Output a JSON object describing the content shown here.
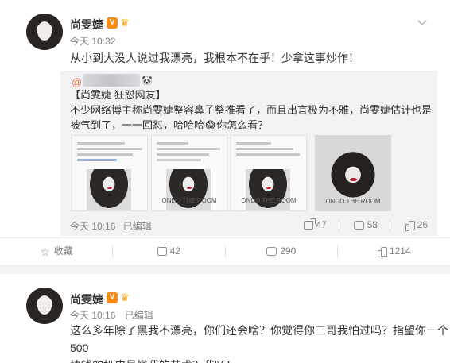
{
  "post1": {
    "author": "尚雯婕",
    "verified_badge": "V",
    "member_icon": "crown-icon",
    "time": "今天 10:32",
    "text": "从小到大没人说过我漂亮，我根本不在乎！少拿这事炒作！",
    "repost": {
      "at": "@",
      "extra_icons": "🐼",
      "line1": "【尚雯婕 狂怼网友】",
      "line2": "不少网络博主称尚雯婕整容鼻子整推看了，而且出言极为不雅，尚雯婕估计也是被气到了，一一回怼，哈哈哈😂你怎么看？",
      "thumb_watermark": "ONDO THE ROOM",
      "time": "今天 10:16",
      "edited": "已编辑",
      "reposts": "47",
      "comments": "58",
      "likes": "26"
    },
    "actions": {
      "favorite": "收藏",
      "reposts": "42",
      "comments": "290",
      "likes": "1214"
    }
  },
  "post2": {
    "author": "尚雯婕",
    "verified_badge": "V",
    "time": "今天 10:16",
    "edited": "已编辑",
    "text_line1": "这么多年除了黑我不漂亮，你们还会啥？你觉得你三哥我怕过吗？指望你一个500",
    "text_line2": "块钱的扒皮号懂我的艺术？我呸！"
  },
  "colors": {
    "accent": "#eb7350",
    "badge": "#f58b19",
    "bg_repost": "#f2f2f5"
  }
}
